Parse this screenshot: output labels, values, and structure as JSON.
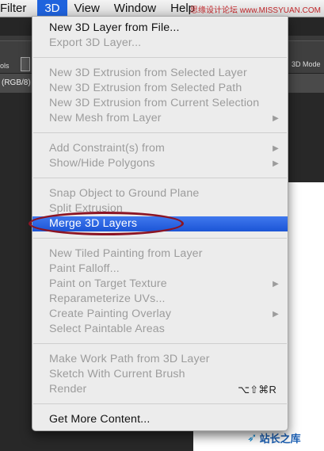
{
  "menubar": {
    "items": [
      "Filter",
      "3D",
      "View",
      "Window",
      "Help"
    ],
    "active_index": 1,
    "watermark": "思缘设计论坛 www.MISSYUAN.COM"
  },
  "toolbar": {
    "tool_label": "ols",
    "mode_label": "3D Mode"
  },
  "document_tab": {
    "label": "(RGB/8)"
  },
  "menu": {
    "items": [
      {
        "label": "New 3D Layer from File...",
        "state": "enabled"
      },
      {
        "label": "Export 3D Layer...",
        "state": "disabled"
      },
      {
        "label": "New 3D Extrusion from Selected Layer",
        "state": "disabled"
      },
      {
        "label": "New 3D Extrusion from Selected Path",
        "state": "disabled"
      },
      {
        "label": "New 3D Extrusion from Current Selection",
        "state": "disabled"
      },
      {
        "label": "New Mesh from Layer",
        "state": "disabled",
        "submenu": true
      },
      {
        "label": "Add Constraint(s) from",
        "state": "disabled",
        "submenu": true
      },
      {
        "label": "Show/Hide Polygons",
        "state": "disabled",
        "submenu": true
      },
      {
        "label": "Snap Object to Ground Plane",
        "state": "disabled"
      },
      {
        "label": "Split Extrusion",
        "state": "disabled"
      },
      {
        "label": "Merge 3D Layers",
        "state": "highlighted"
      },
      {
        "label": "New Tiled Painting from Layer",
        "state": "disabled"
      },
      {
        "label": "Paint Falloff...",
        "state": "disabled"
      },
      {
        "label": "Paint on Target Texture",
        "state": "disabled",
        "submenu": true
      },
      {
        "label": "Reparameterize UVs...",
        "state": "disabled"
      },
      {
        "label": "Create Painting Overlay",
        "state": "disabled",
        "submenu": true
      },
      {
        "label": "Select Paintable Areas",
        "state": "disabled"
      },
      {
        "label": "Make Work Path from 3D Layer",
        "state": "disabled"
      },
      {
        "label": "Sketch With Current Brush",
        "state": "disabled"
      },
      {
        "label": "Render",
        "state": "disabled",
        "shortcut": "⌥⇧⌘R"
      },
      {
        "label": "Get More Content...",
        "state": "enabled"
      }
    ],
    "submenu_arrow": "▶"
  },
  "watermark_bottom": {
    "icon": "bird-icon",
    "text": "站长之库"
  },
  "colors": {
    "highlight": "#1f63dd",
    "circle": "#8b1424",
    "menu_bg": "#ececec"
  }
}
